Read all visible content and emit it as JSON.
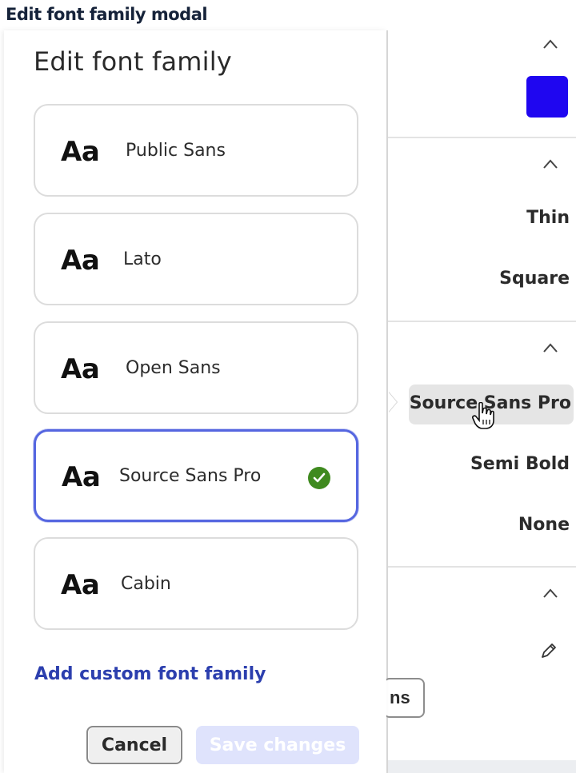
{
  "caption": "Edit font family modal",
  "modal": {
    "title": "Edit font family",
    "sample_glyph": "Aa",
    "fonts": [
      {
        "name": "Public Sans",
        "selected": false
      },
      {
        "name": "Lato",
        "selected": false
      },
      {
        "name": "Open Sans",
        "selected": false
      },
      {
        "name": "Source Sans Pro",
        "selected": true
      },
      {
        "name": "Cabin",
        "selected": false
      }
    ],
    "add_link": "Add custom font family",
    "cancel_label": "Cancel",
    "save_label": "Save changes"
  },
  "side_panel": {
    "color_swatch": "#1f06f0",
    "props": {
      "weight_thin": "Thin",
      "shape": "Square",
      "font_family": "Source Sans Pro",
      "font_weight": "Semi Bold",
      "decoration": "None"
    },
    "chip_text": "ns"
  },
  "colors": {
    "accent": "#5566e0",
    "link": "#2c3fae",
    "check": "#3f8a1f",
    "save_disabled": "#dfe3fc"
  }
}
